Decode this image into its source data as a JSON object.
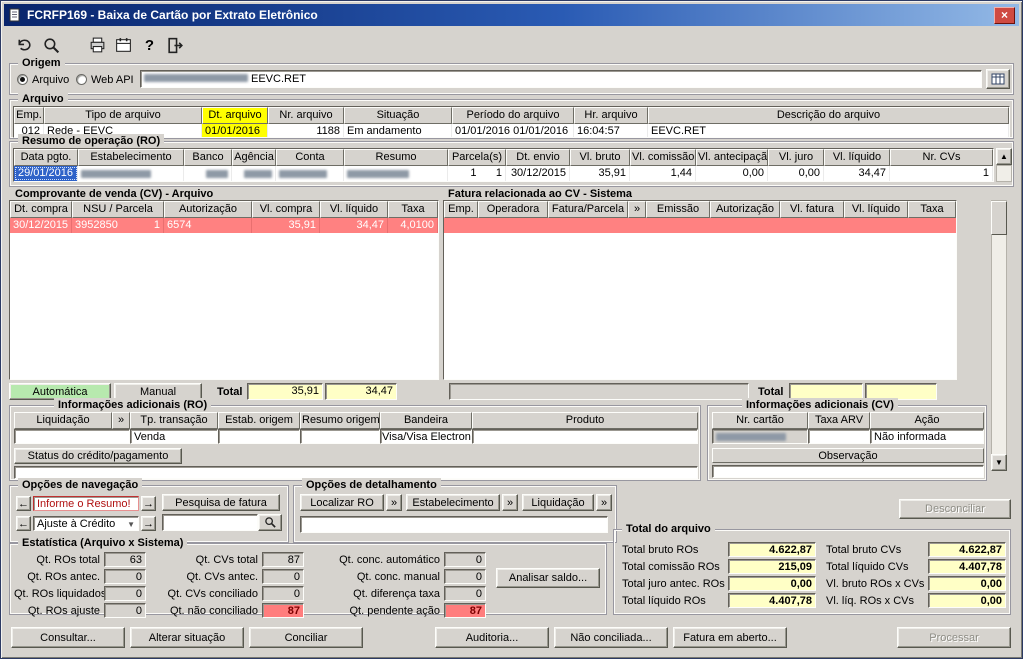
{
  "window": {
    "title": "FCRFP169 - Baixa de Cartão por Extrato Eletrônico"
  },
  "icons": {
    "close": "×",
    "up_arrow": "▲",
    "down_arrow": "▼",
    "left_arrow": "←",
    "right_arrow": "→",
    "combo_arrow": "▼"
  },
  "toolbar": {
    "buttons": [
      "undo",
      "search",
      "print",
      "calendar",
      "help",
      "exit"
    ]
  },
  "origem": {
    "label": "Origem",
    "radio_arquivo": "Arquivo",
    "radio_webapi": "Web API",
    "file_value": "EEVC.RET"
  },
  "arquivo": {
    "label": "Arquivo",
    "headers": [
      "Emp.",
      "Tipo de arquivo",
      "Dt. arquivo",
      "Nr. arquivo",
      "Situação",
      "Período do arquivo",
      "Hr. arquivo",
      "Descrição do arquivo"
    ],
    "row": {
      "emp": "012",
      "tipo": "Rede - EEVC",
      "dt_arquivo": "01/01/2016",
      "nr_arquivo": "1188",
      "situacao": "Em andamento",
      "periodo": "01/01/2016  01/01/2016",
      "hr_arquivo": "16:04:57",
      "descricao": "EEVC.RET"
    }
  },
  "ro": {
    "label": "Resumo de operação (RO)",
    "headers": [
      "Data pgto.",
      "Estabelecimento",
      "Banco",
      "Agência",
      "Conta",
      "Resumo",
      "Parcela(s)",
      "Dt. envio",
      "Vl. bruto",
      "Vl. comissão",
      "Vl. antecipação",
      "Vl. juro",
      "Vl. líquido",
      "Nr. CVs"
    ],
    "row": {
      "data_pgto": "29/01/2016",
      "parcela_1": "1",
      "parcela_2": "1",
      "dt_envio": "30/12/2015",
      "vl_bruto": "35,91",
      "vl_comissao": "1,44",
      "vl_antecipacao": "0,00",
      "vl_juro": "0,00",
      "vl_liquido": "34,47",
      "nr_cvs": "1"
    }
  },
  "cv": {
    "label": "Comprovante de venda (CV) - Arquivo",
    "headers": [
      "Dt. compra",
      "NSU / Parcela",
      "Autorização",
      "Vl. compra",
      "Vl. líquido",
      "Taxa"
    ],
    "row": {
      "dt_compra": "30/12/2015",
      "nsu": "3952850",
      "parcela": "1",
      "autorizacao": "6574",
      "vl_compra": "35,91",
      "vl_liquido": "34,47",
      "taxa": "4,0100"
    },
    "automatica": "Automática",
    "manual": "Manual",
    "total_label": "Total",
    "total_compra": "35,91",
    "total_liquido": "34,47"
  },
  "fatura": {
    "label": "Fatura relacionada ao CV - Sistema",
    "headers": [
      "Emp.",
      "Operadora",
      "Fatura/Parcela",
      "»",
      "Emissão",
      "Autorização",
      "Vl. fatura",
      "Vl. líquido",
      "Taxa"
    ],
    "total_label": "Total"
  },
  "info_ro": {
    "label": "Informações adicionais (RO)",
    "headers": [
      "Liquidação",
      "»",
      "Tp. transação",
      "Estab. origem",
      "Resumo origem",
      "Bandeira",
      "Produto"
    ],
    "values": {
      "tp_transacao": "Venda",
      "bandeira": "Visa/Visa Electron"
    },
    "status_button": "Status do crédito/pagamento"
  },
  "info_cv": {
    "label": "Informações adicionais (CV)",
    "headers": [
      "Nr. cartão",
      "Taxa ARV",
      "Ação"
    ],
    "values": {
      "acao": "Não informada"
    },
    "observacao": "Observação"
  },
  "navegacao": {
    "label": "Opções de navegação",
    "combo_resumo": "Informe o Resumo!",
    "combo_ajuste": "Ajuste à Crédito",
    "pesquisa_fatura": "Pesquisa de fatura"
  },
  "detalhamento": {
    "label": "Opções de detalhamento",
    "localizar_ro": "Localizar RO",
    "estabelecimento": "Estabelecimento",
    "liquidacao": "Liquidação",
    "chevron": "»"
  },
  "desconciliar": "Desconciliar",
  "estatistica": {
    "label": "Estatística (Arquivo x Sistema)",
    "col1": [
      {
        "label": "Qt. ROs total",
        "value": "63"
      },
      {
        "label": "Qt. ROs antec.",
        "value": "0"
      },
      {
        "label": "Qt. ROs liquidados",
        "value": "0"
      },
      {
        "label": "Qt. ROs ajuste",
        "value": "0"
      }
    ],
    "col2": [
      {
        "label": "Qt. CVs total",
        "value": "87"
      },
      {
        "label": "Qt. CVs antec.",
        "value": "0"
      },
      {
        "label": "Qt. CVs conciliado",
        "value": "0"
      },
      {
        "label": "Qt. não conciliado",
        "value": "87"
      }
    ],
    "col3": [
      {
        "label": "Qt. conc. automático",
        "value": "0"
      },
      {
        "label": "Qt. conc. manual",
        "value": "0"
      },
      {
        "label": "Qt. diferença taxa",
        "value": "0"
      },
      {
        "label": "Qt. pendente ação",
        "value": "87"
      }
    ],
    "analisar_saldo": "Analisar saldo..."
  },
  "total_arquivo": {
    "label": "Total do arquivo",
    "rows": [
      {
        "label1": "Total bruto ROs",
        "value1": "4.622,87",
        "label2": "Total bruto CVs",
        "value2": "4.622,87"
      },
      {
        "label1": "Total comissão ROs",
        "value1": "215,09",
        "label2": "Total líquido CVs",
        "value2": "4.407,78"
      },
      {
        "label1": "Total juro antec. ROs",
        "value1": "0,00",
        "label2": "Vl. bruto ROs x CVs",
        "value2": "0,00"
      },
      {
        "label1": "Total líquido ROs",
        "value1": "4.407,78",
        "label2": "Vl. líq. ROs x CVs",
        "value2": "0,00"
      }
    ]
  },
  "actions": {
    "consultar": "Consultar...",
    "alterar_situacao": "Alterar situação",
    "conciliar": "Conciliar",
    "auditoria": "Auditoria...",
    "nao_conciliada": "Não conciliada...",
    "fatura_em_aberto": "Fatura em aberto...",
    "processar": "Processar"
  },
  "colors": {
    "sort_highlight": "#ffff00",
    "alert_red": "#ff7d7d",
    "row_red": "#ff8181",
    "selected_blue": "#2e62c8",
    "total_yellow": "#ffffc6",
    "auto_green": "#b7e9ae"
  }
}
